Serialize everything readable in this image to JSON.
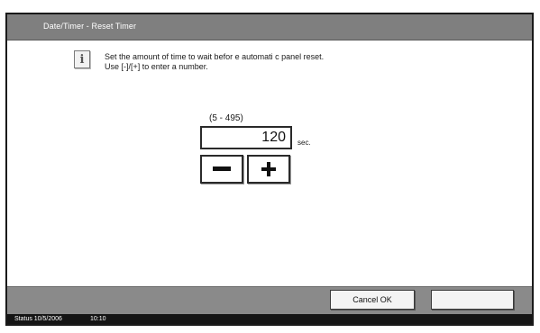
{
  "window": {
    "title": "Date/Timer - Reset Timer"
  },
  "message": {
    "line1": "Set the amount of time to wait befor e automati c panel reset.",
    "line2": "Use [-]/[+] to enter a number."
  },
  "input": {
    "range": "(5 - 495)",
    "value": "120",
    "unit": "sec."
  },
  "buttons": {
    "cancel_ok": "Cancel OK",
    "blank": ""
  },
  "status": {
    "status_date": "Status 10/5/2006",
    "time": "10:10"
  },
  "icons": {
    "info": "info-icon",
    "minus": "minus-icon",
    "plus": "plus-icon"
  },
  "colors": {
    "titlebar": "#7f7f7f",
    "footer": "#8a8a8a",
    "statusbar": "#151515"
  }
}
